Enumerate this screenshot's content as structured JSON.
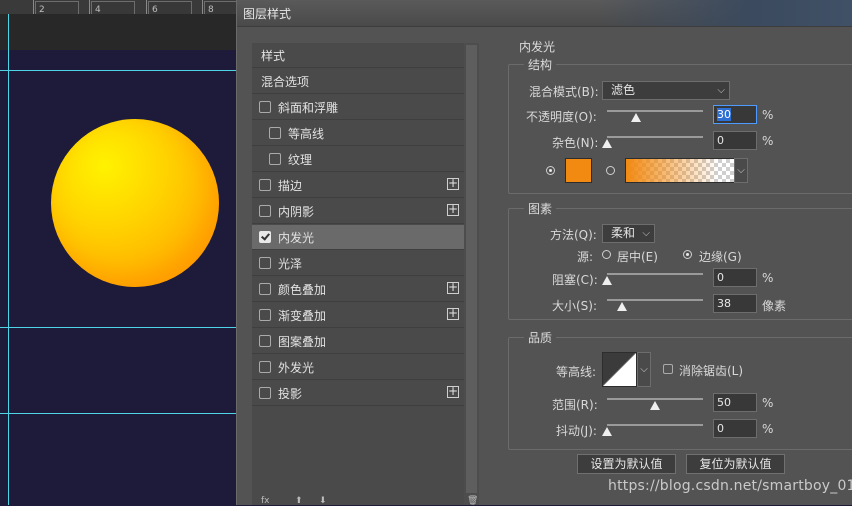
{
  "ruler": {
    "numbers": [
      "2",
      "4",
      "6",
      "8"
    ]
  },
  "dialog": {
    "title": "图层样式"
  },
  "style_list": {
    "items": [
      {
        "label": "样式",
        "has_checkbox": false,
        "checked": false,
        "has_plus": false,
        "indent": false,
        "selected": false
      },
      {
        "label": "混合选项",
        "has_checkbox": false,
        "checked": false,
        "has_plus": false,
        "indent": false,
        "selected": false
      },
      {
        "label": "斜面和浮雕",
        "has_checkbox": true,
        "checked": false,
        "has_plus": false,
        "indent": false,
        "selected": false
      },
      {
        "label": "等高线",
        "has_checkbox": true,
        "checked": false,
        "has_plus": false,
        "indent": true,
        "selected": false
      },
      {
        "label": "纹理",
        "has_checkbox": true,
        "checked": false,
        "has_plus": false,
        "indent": true,
        "selected": false
      },
      {
        "label": "描边",
        "has_checkbox": true,
        "checked": false,
        "has_plus": true,
        "indent": false,
        "selected": false
      },
      {
        "label": "内阴影",
        "has_checkbox": true,
        "checked": false,
        "has_plus": true,
        "indent": false,
        "selected": false
      },
      {
        "label": "内发光",
        "has_checkbox": true,
        "checked": true,
        "has_plus": false,
        "indent": false,
        "selected": true
      },
      {
        "label": "光泽",
        "has_checkbox": true,
        "checked": false,
        "has_plus": false,
        "indent": false,
        "selected": false
      },
      {
        "label": "颜色叠加",
        "has_checkbox": true,
        "checked": false,
        "has_plus": true,
        "indent": false,
        "selected": false
      },
      {
        "label": "渐变叠加",
        "has_checkbox": true,
        "checked": false,
        "has_plus": true,
        "indent": false,
        "selected": false
      },
      {
        "label": "图案叠加",
        "has_checkbox": true,
        "checked": false,
        "has_plus": false,
        "indent": false,
        "selected": false
      },
      {
        "label": "外发光",
        "has_checkbox": true,
        "checked": false,
        "has_plus": false,
        "indent": false,
        "selected": false
      },
      {
        "label": "投影",
        "has_checkbox": true,
        "checked": false,
        "has_plus": true,
        "indent": false,
        "selected": false
      }
    ],
    "plus_glyph": "+",
    "footer_glyphs": [
      "fx",
      "⬆",
      "⬇",
      "🗑"
    ]
  },
  "inner_glow": {
    "title": "内发光",
    "structure": {
      "title": "结构",
      "blend_mode_label": "混合模式(B):",
      "blend_mode_value": "滤色",
      "opacity_label": "不透明度(O):",
      "opacity_value": "30",
      "opacity_level": 0.3,
      "noise_label": "杂色(N):",
      "noise_value": "0",
      "noise_level": 0,
      "percent": "%",
      "color_swatch": "#f28a12"
    },
    "elements": {
      "title": "图素",
      "method_label": "方法(Q):",
      "method_value": "柔和",
      "source_label": "源:",
      "center_label": "居中(E)",
      "edge_label": "边缘(G)",
      "choke_label": "阻塞(C):",
      "choke_value": "0",
      "choke_level": 0,
      "size_label": "大小(S):",
      "size_value": "38",
      "size_level": 0.16,
      "percent": "%",
      "pixels": "像素"
    },
    "quality": {
      "title": "品质",
      "contour_label": "等高线:",
      "anti_alias_label": "消除锯齿(L)",
      "range_label": "范围(R):",
      "range_value": "50",
      "range_level": 0.5,
      "jitter_label": "抖动(J):",
      "jitter_value": "0",
      "jitter_level": 0,
      "percent": "%"
    },
    "buttons": {
      "make_default": "设置为默认值",
      "reset_default": "复位为默认值"
    }
  },
  "dropdown_glyph": "⌵",
  "watermark": "https://blog.csdn.net/smartboy_01",
  "colors": {
    "accent_selection": "#2d6fd4",
    "sun": "#ffc400",
    "guides": "#4fd3e6"
  }
}
